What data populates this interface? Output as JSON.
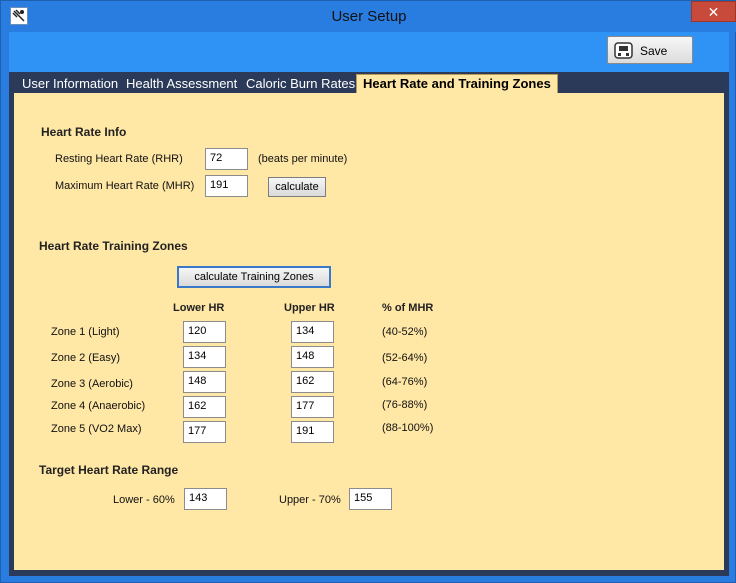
{
  "window": {
    "title": "User Setup",
    "close_glyph": "✕"
  },
  "toolbar": {
    "save_label": "Save"
  },
  "tabs": [
    {
      "label": "User Information"
    },
    {
      "label": "Health Assessment"
    },
    {
      "label": "Caloric Burn Rates"
    },
    {
      "label": "Heart Rate and Training Zones",
      "active": true
    }
  ],
  "hr_info": {
    "heading": "Heart Rate Info",
    "rhr_label": "Resting Heart Rate (RHR)",
    "rhr_value": "72",
    "rhr_unit": "(beats per minute)",
    "mhr_label": "Maximum Heart Rate (MHR)",
    "mhr_value": "191",
    "calculate_label": "calculate"
  },
  "zones": {
    "heading": "Heart Rate Training Zones",
    "calc_button": "calculate Training Zones",
    "col_lower": "Lower HR",
    "col_upper": "Upper HR",
    "col_pct": "% of MHR",
    "rows": [
      {
        "name": "Zone 1 (Light)",
        "lower": "120",
        "upper": "134",
        "pct": "(40-52%)"
      },
      {
        "name": "Zone 2 (Easy)",
        "lower": "134",
        "upper": "148",
        "pct": "(52-64%)"
      },
      {
        "name": "Zone 3 (Aerobic)",
        "lower": "148",
        "upper": "162",
        "pct": "(64-76%)"
      },
      {
        "name": "Zone 4 (Anaerobic)",
        "lower": "162",
        "upper": "177",
        "pct": "(76-88%)"
      },
      {
        "name": "Zone 5 (VO2 Max)",
        "lower": "177",
        "upper": "191",
        "pct": "(88-100%)"
      }
    ]
  },
  "target": {
    "heading": "Target Heart Rate Range",
    "lower_label": "Lower - 60%",
    "lower_value": "143",
    "upper_label": "Upper - 70%",
    "upper_value": "155"
  }
}
